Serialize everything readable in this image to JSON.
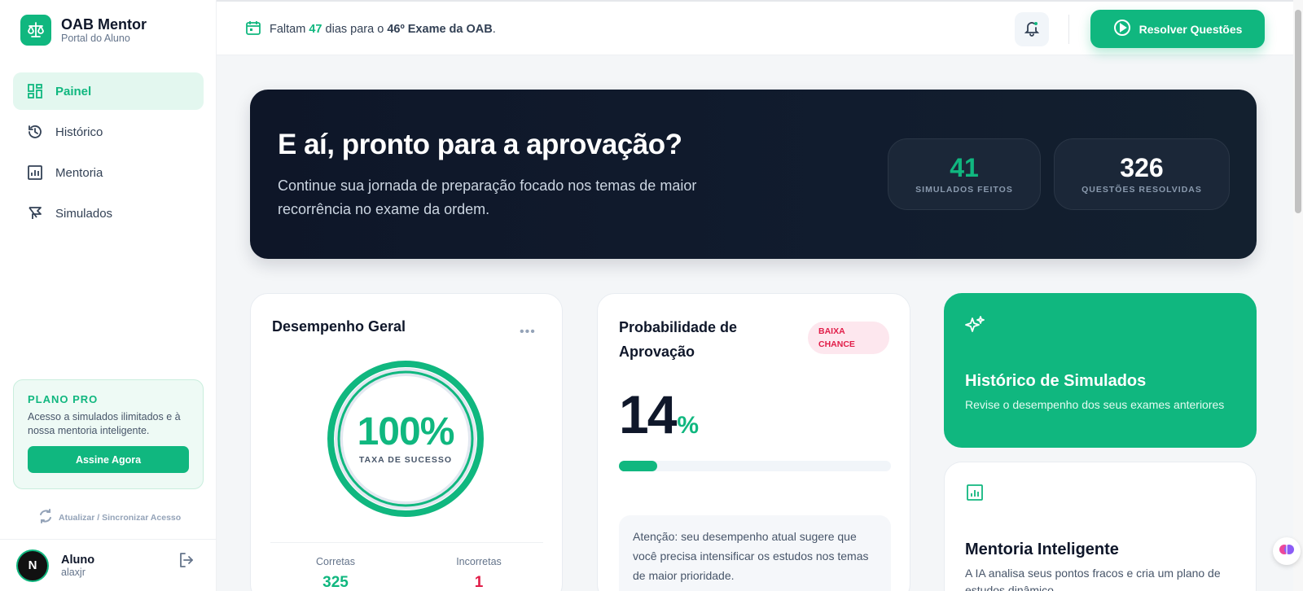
{
  "brand": {
    "title": "OAB Mentor",
    "subtitle": "Portal do Aluno"
  },
  "sidebar": {
    "items": [
      {
        "label": "Painel",
        "icon": "dashboard-icon",
        "active": true
      },
      {
        "label": "Histórico",
        "icon": "history-icon",
        "active": false
      },
      {
        "label": "Mentoria",
        "icon": "chart-icon",
        "active": false
      },
      {
        "label": "Simulados",
        "icon": "exam-icon",
        "active": false
      }
    ],
    "plan": {
      "title": "PLANO PRO",
      "description": "Acesso a simulados ilimitados e à nossa mentoria inteligente.",
      "button": "Assine Agora"
    },
    "sync_label": "Atualizar / Sincronizar Acesso",
    "user": {
      "initial": "N",
      "name": "Aluno",
      "handle": "alaxjr"
    }
  },
  "topbar": {
    "countdown_prefix": "Faltam",
    "countdown_days": "47",
    "countdown_middle": "dias para o",
    "countdown_exam": "46º Exame da OAB",
    "countdown_suffix": ".",
    "cta_label": "Resolver Questões"
  },
  "hero": {
    "title": "E aí, pronto para a aprovação?",
    "subtitle": "Continue sua jornada de preparação focado nos temas de maior recorrência no exame da ordem.",
    "stats": [
      {
        "value": "41",
        "label": "SIMULADOS FEITOS",
        "color": "#10b77f"
      },
      {
        "value": "326",
        "label": "QUESTÕES RESOLVIDAS",
        "color": "#ffffff"
      }
    ]
  },
  "performance": {
    "title": "Desempenho Geral",
    "more": "•••",
    "rate": "100%",
    "rate_fraction": 1.0,
    "rate_caption": "TAXA DE SUCESSO",
    "correct_label": "Corretas",
    "correct_value": "325",
    "incorrect_label": "Incorretas",
    "incorrect_value": "1"
  },
  "probability": {
    "title_line1": "Probabilidade de",
    "title_line2": "Aprovação",
    "badge_line1": "BAIXA",
    "badge_line2": "CHANCE",
    "value": "14",
    "unit": "%",
    "progress": 0.14,
    "warning": "Atenção: seu desempenho atual sugere que você precisa intensificar os estudos nos temas de maior prioridade."
  },
  "history_card": {
    "title": "Histórico de Simulados",
    "description": "Revise o desempenho dos seus exames anteriores"
  },
  "mentor_card": {
    "title": "Mentoria Inteligente",
    "description": "A IA analisa seus pontos fracos e cria um plano de estudos dinâmico."
  },
  "colors": {
    "accent": "#10b77f",
    "dark": "#0f172a",
    "danger": "#e11d48"
  }
}
